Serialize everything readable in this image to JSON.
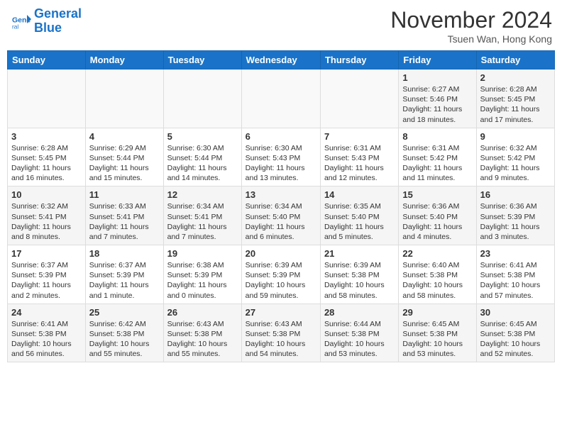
{
  "logo": {
    "line1": "General",
    "line2": "Blue"
  },
  "title": "November 2024",
  "subtitle": "Tsuen Wan, Hong Kong",
  "days_of_week": [
    "Sunday",
    "Monday",
    "Tuesday",
    "Wednesday",
    "Thursday",
    "Friday",
    "Saturday"
  ],
  "weeks": [
    [
      {
        "day": "",
        "info": ""
      },
      {
        "day": "",
        "info": ""
      },
      {
        "day": "",
        "info": ""
      },
      {
        "day": "",
        "info": ""
      },
      {
        "day": "",
        "info": ""
      },
      {
        "day": "1",
        "info": "Sunrise: 6:27 AM\nSunset: 5:46 PM\nDaylight: 11 hours and 18 minutes."
      },
      {
        "day": "2",
        "info": "Sunrise: 6:28 AM\nSunset: 5:45 PM\nDaylight: 11 hours and 17 minutes."
      }
    ],
    [
      {
        "day": "3",
        "info": "Sunrise: 6:28 AM\nSunset: 5:45 PM\nDaylight: 11 hours and 16 minutes."
      },
      {
        "day": "4",
        "info": "Sunrise: 6:29 AM\nSunset: 5:44 PM\nDaylight: 11 hours and 15 minutes."
      },
      {
        "day": "5",
        "info": "Sunrise: 6:30 AM\nSunset: 5:44 PM\nDaylight: 11 hours and 14 minutes."
      },
      {
        "day": "6",
        "info": "Sunrise: 6:30 AM\nSunset: 5:43 PM\nDaylight: 11 hours and 13 minutes."
      },
      {
        "day": "7",
        "info": "Sunrise: 6:31 AM\nSunset: 5:43 PM\nDaylight: 11 hours and 12 minutes."
      },
      {
        "day": "8",
        "info": "Sunrise: 6:31 AM\nSunset: 5:42 PM\nDaylight: 11 hours and 11 minutes."
      },
      {
        "day": "9",
        "info": "Sunrise: 6:32 AM\nSunset: 5:42 PM\nDaylight: 11 hours and 9 minutes."
      }
    ],
    [
      {
        "day": "10",
        "info": "Sunrise: 6:32 AM\nSunset: 5:41 PM\nDaylight: 11 hours and 8 minutes."
      },
      {
        "day": "11",
        "info": "Sunrise: 6:33 AM\nSunset: 5:41 PM\nDaylight: 11 hours and 7 minutes."
      },
      {
        "day": "12",
        "info": "Sunrise: 6:34 AM\nSunset: 5:41 PM\nDaylight: 11 hours and 7 minutes."
      },
      {
        "day": "13",
        "info": "Sunrise: 6:34 AM\nSunset: 5:40 PM\nDaylight: 11 hours and 6 minutes."
      },
      {
        "day": "14",
        "info": "Sunrise: 6:35 AM\nSunset: 5:40 PM\nDaylight: 11 hours and 5 minutes."
      },
      {
        "day": "15",
        "info": "Sunrise: 6:36 AM\nSunset: 5:40 PM\nDaylight: 11 hours and 4 minutes."
      },
      {
        "day": "16",
        "info": "Sunrise: 6:36 AM\nSunset: 5:39 PM\nDaylight: 11 hours and 3 minutes."
      }
    ],
    [
      {
        "day": "17",
        "info": "Sunrise: 6:37 AM\nSunset: 5:39 PM\nDaylight: 11 hours and 2 minutes."
      },
      {
        "day": "18",
        "info": "Sunrise: 6:37 AM\nSunset: 5:39 PM\nDaylight: 11 hours and 1 minute."
      },
      {
        "day": "19",
        "info": "Sunrise: 6:38 AM\nSunset: 5:39 PM\nDaylight: 11 hours and 0 minutes."
      },
      {
        "day": "20",
        "info": "Sunrise: 6:39 AM\nSunset: 5:39 PM\nDaylight: 10 hours and 59 minutes."
      },
      {
        "day": "21",
        "info": "Sunrise: 6:39 AM\nSunset: 5:38 PM\nDaylight: 10 hours and 58 minutes."
      },
      {
        "day": "22",
        "info": "Sunrise: 6:40 AM\nSunset: 5:38 PM\nDaylight: 10 hours and 58 minutes."
      },
      {
        "day": "23",
        "info": "Sunrise: 6:41 AM\nSunset: 5:38 PM\nDaylight: 10 hours and 57 minutes."
      }
    ],
    [
      {
        "day": "24",
        "info": "Sunrise: 6:41 AM\nSunset: 5:38 PM\nDaylight: 10 hours and 56 minutes."
      },
      {
        "day": "25",
        "info": "Sunrise: 6:42 AM\nSunset: 5:38 PM\nDaylight: 10 hours and 55 minutes."
      },
      {
        "day": "26",
        "info": "Sunrise: 6:43 AM\nSunset: 5:38 PM\nDaylight: 10 hours and 55 minutes."
      },
      {
        "day": "27",
        "info": "Sunrise: 6:43 AM\nSunset: 5:38 PM\nDaylight: 10 hours and 54 minutes."
      },
      {
        "day": "28",
        "info": "Sunrise: 6:44 AM\nSunset: 5:38 PM\nDaylight: 10 hours and 53 minutes."
      },
      {
        "day": "29",
        "info": "Sunrise: 6:45 AM\nSunset: 5:38 PM\nDaylight: 10 hours and 53 minutes."
      },
      {
        "day": "30",
        "info": "Sunrise: 6:45 AM\nSunset: 5:38 PM\nDaylight: 10 hours and 52 minutes."
      }
    ]
  ]
}
